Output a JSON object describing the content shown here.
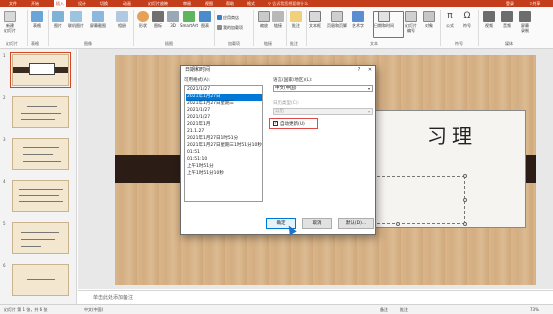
{
  "ribbon_tabs": {
    "file": "文件",
    "home": "开始",
    "insert": "插入",
    "design": "设计",
    "transitions": "切换",
    "animations": "动画",
    "slideshow": "幻灯片放映",
    "review": "审阅",
    "view": "视图",
    "help": "帮助",
    "format": "格式",
    "search_placeholder": "告诉我您想要做什么",
    "login": "登录",
    "share": "共享"
  },
  "ribbon": {
    "new_slide": "新建\n幻灯片",
    "table": "表格",
    "image": "图片",
    "online_image": "联机图片",
    "screenshot": "屏幕截图",
    "album": "相册",
    "shapes": "形状",
    "icons": "图标",
    "3d": "3D",
    "smartart": "SmartArt",
    "chart": "图表",
    "store": "应用商店",
    "my_addins": "我的加载项",
    "zoom": "缩放",
    "link": "链接",
    "comment": "批注",
    "textbox": "文本框",
    "header_footer": "页眉和页脚",
    "wordart": "艺术字",
    "datetime": "日期和时间",
    "slide_number": "幻灯片\n编号",
    "object": "对象",
    "equation": "公式",
    "symbol": "符号",
    "video": "视频",
    "audio": "音频",
    "screen_record": "屏幕\n录制",
    "groups": {
      "slides": "幻灯片",
      "tables": "表格",
      "images": "图像",
      "illustrations": "插图",
      "addins": "加载项",
      "links": "链接",
      "comments": "批注",
      "text": "文本",
      "symbols": "符号",
      "media": "媒体"
    }
  },
  "thumbnails": [
    "1",
    "2",
    "3",
    "4",
    "5",
    "6"
  ],
  "slide": {
    "title_text": "习理"
  },
  "notes_placeholder": "单击此处添加备注",
  "status": {
    "slide_info": "幻灯片 第 1 张，共 6 张",
    "language": "中文(中国)",
    "notes": "备注",
    "comments": "批注",
    "zoom": "73%"
  },
  "dialog": {
    "title": "日期和时间",
    "formats_label": "可用格式(A):",
    "formats": [
      "2021/1/27",
      "2021年1月27日",
      "2021年1月27日星期三",
      "2021/1/27",
      "2021/1/27",
      "2021年1月",
      "21.1.27",
      "2021年1月27日1时51分",
      "2021年1月27日星期三1时51分10秒",
      "01:51",
      "01:51:10",
      "上午1时51分",
      "上午1时51分10秒"
    ],
    "selected_format_index": 1,
    "language_label": "语言(国家/地区)(L):",
    "language_value": "中文(中国)",
    "calendar_label": "日历类型(C):",
    "calendar_value": "公历",
    "auto_update_label": "自动更新(U)",
    "auto_update_checked": true,
    "ok": "确定",
    "cancel": "取消",
    "set_default": "默认(D)...",
    "help_glyph": "?",
    "close_glyph": "✕"
  }
}
